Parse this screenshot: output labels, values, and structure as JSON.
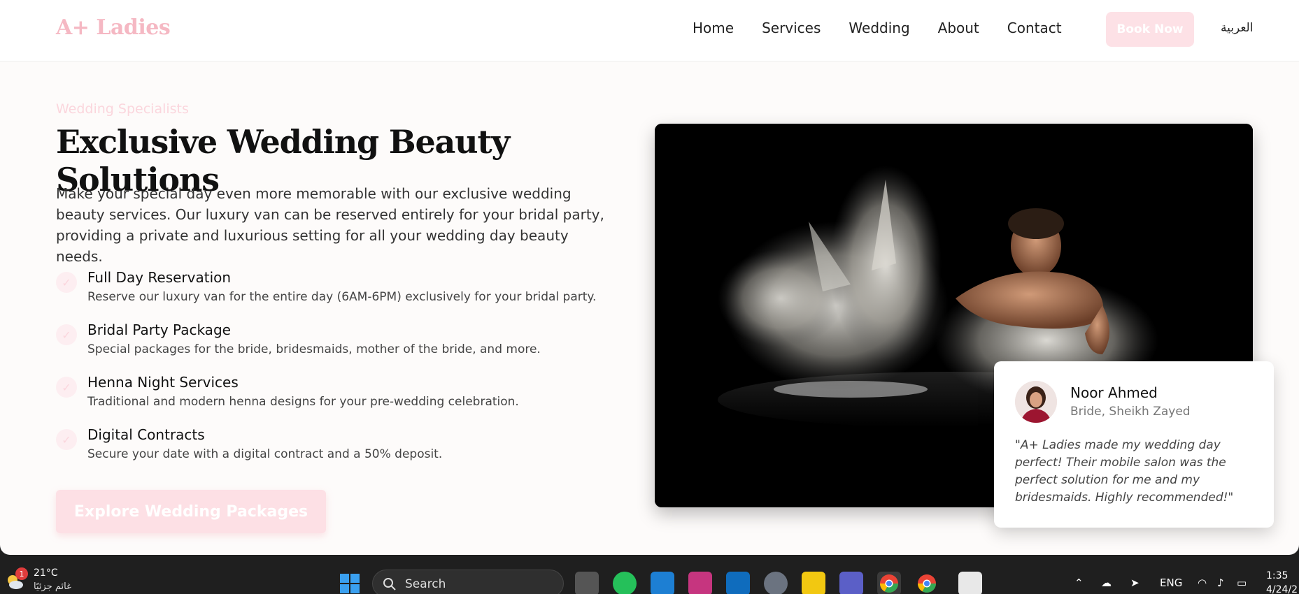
{
  "nav": {
    "logo": "A+ Ladies",
    "links": [
      "Home",
      "Services",
      "Wedding",
      "About",
      "Contact"
    ],
    "book_label": "Book Now",
    "lang_label": "العربية"
  },
  "hero": {
    "kicker": "Wedding Specialists",
    "title": "Exclusive Wedding Beauty Solutions",
    "intro": "Make your special day even more memorable with our exclusive wedding beauty services. Our luxury van can be reserved entirely for your bridal party, providing a private and luxurious setting for all your wedding day beauty needs.",
    "features": [
      {
        "title": "Full Day Reservation",
        "desc": "Reserve our luxury van for the entire day (6AM-6PM) exclusively for your bridal party."
      },
      {
        "title": "Bridal Party Package",
        "desc": "Special packages for the bride, bridesmaids, mother of the bride, and more."
      },
      {
        "title": "Henna Night Services",
        "desc": "Traditional and modern henna designs for your pre-wedding celebration."
      },
      {
        "title": "Digital Contracts",
        "desc": "Secure your date with a digital contract and a 50% deposit."
      }
    ],
    "cta_label": "Explore Wedding Packages"
  },
  "testimonial": {
    "name": "Noor Ahmed",
    "role": "Bride, Sheikh Zayed",
    "quote": "\"A+ Ladies made my wedding day perfect! Their mobile salon was the perfect solution for me and my bridesmaids. Highly recommended!\""
  },
  "taskbar": {
    "weather_temp": "21°C",
    "weather_cond": "غائم جزئيًا",
    "weather_badge": "1",
    "search_label": "Search",
    "lang": "ENG",
    "time": "1:35",
    "date": "4/24/2"
  },
  "colors": {
    "accent_pink": "#f5b8c3",
    "pale_pink": "#fde1e6",
    "page_bg": "#fdfbfa"
  }
}
